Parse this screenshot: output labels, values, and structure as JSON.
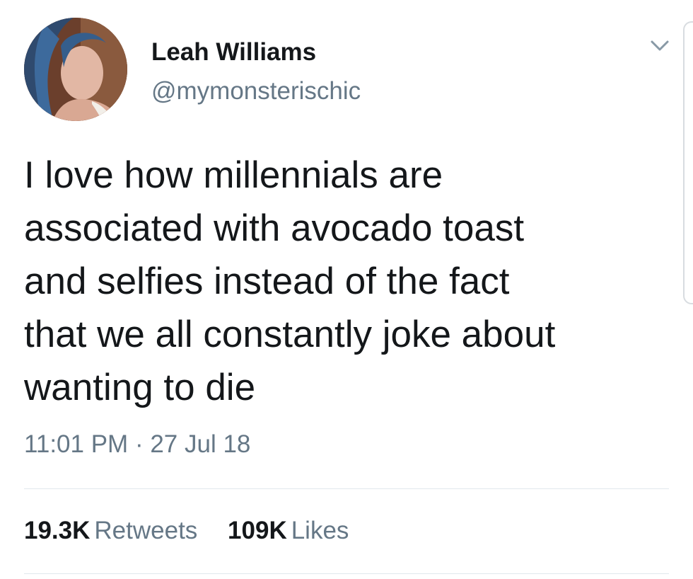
{
  "author": {
    "display_name": "Leah Williams",
    "handle": "@mymonsterischic",
    "avatar_icon": "profile-photo-icon"
  },
  "menu": {
    "caret_icon": "chevron-down-icon"
  },
  "tweet": {
    "lines": [
      "I love how millennials are",
      "associated with avocado toast",
      "and selfies instead of the fact",
      "that we all constantly joke about",
      "wanting to die"
    ]
  },
  "meta": {
    "time": "11:01 PM",
    "separator": "·",
    "date": "27 Jul 18"
  },
  "stats": {
    "retweets_count": "19.3K",
    "retweets_label": "Retweets",
    "likes_count": "109K",
    "likes_label": "Likes"
  },
  "colors": {
    "text_primary": "#14171a",
    "text_secondary": "#657786",
    "divider": "#e1e8ed",
    "background": "#ffffff"
  }
}
